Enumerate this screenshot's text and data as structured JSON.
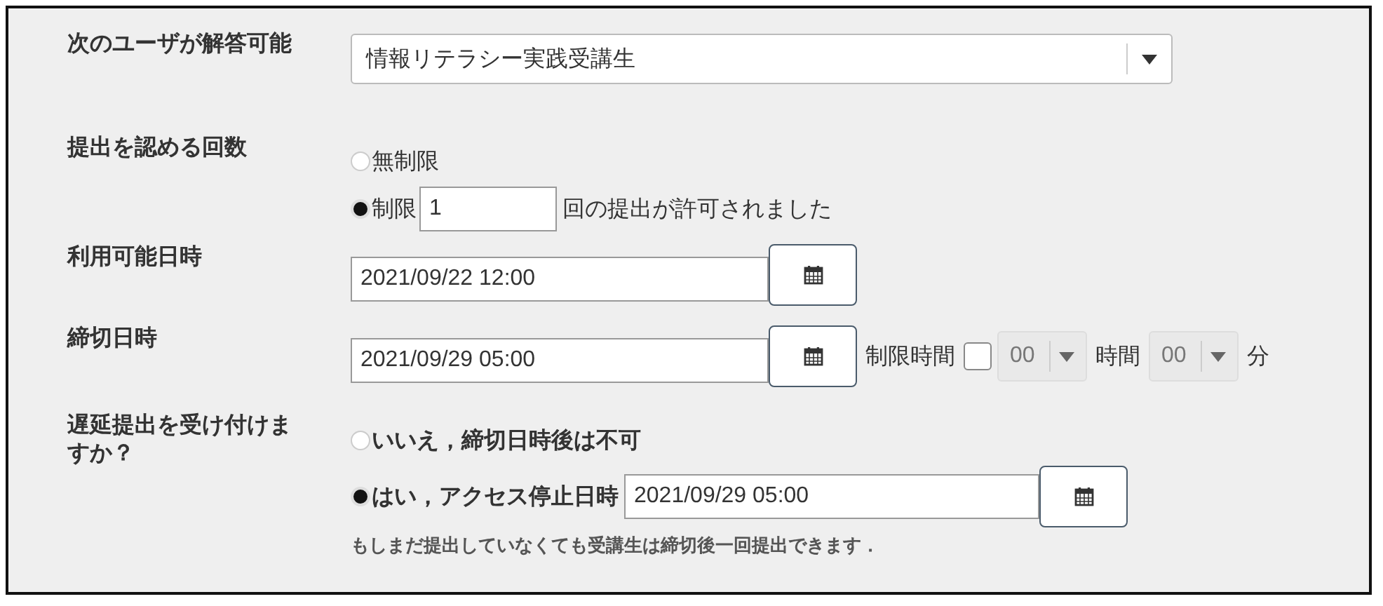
{
  "recipients": {
    "label": "次のユーザが解答可能",
    "value": "情報リテラシー実践受講生"
  },
  "attempts": {
    "label": "提出を認める回数",
    "options": [
      {
        "label": "無制限",
        "selected": false
      },
      {
        "label": "制限",
        "selected": true,
        "value": "1",
        "suffix": "回の提出が許可されました"
      }
    ]
  },
  "available": {
    "label": "利用可能日時",
    "value": "2021/09/22 12:00"
  },
  "due": {
    "label": "締切日時",
    "value": "2021/09/29 05:00",
    "time_limit": {
      "label": "制限時間",
      "checked": false,
      "hours": "00",
      "hours_unit": "時間",
      "minutes": "00",
      "minutes_unit": "分",
      "disabled": true
    }
  },
  "late": {
    "label": "遅延提出を受け付けますか？",
    "options": [
      {
        "label": "いいえ，締切日時後は不可",
        "selected": false
      },
      {
        "label": "はい，アクセス停止日時",
        "selected": true,
        "value": "2021/09/29 05:00"
      }
    ],
    "note": "もしまだ提出していなくても受講生は締切後一回提出できます．"
  }
}
